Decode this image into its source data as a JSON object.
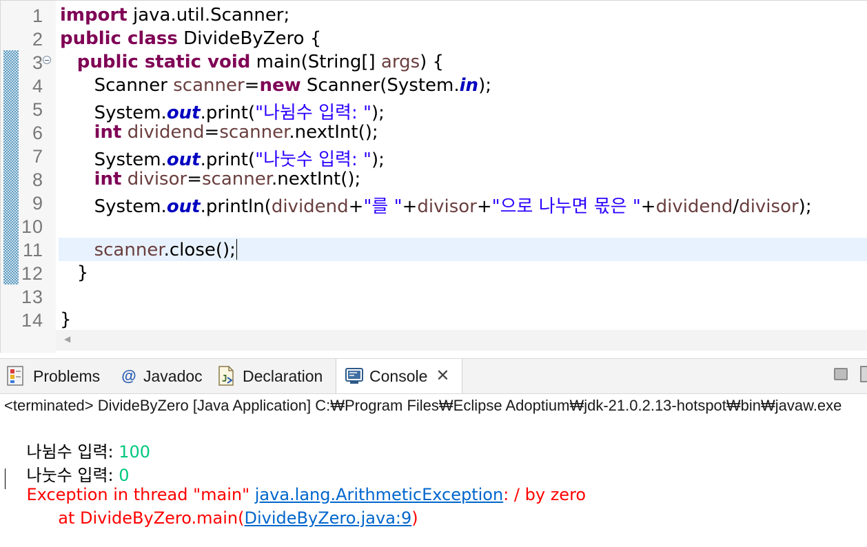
{
  "editor": {
    "lines": [
      {
        "n": "1",
        "tokens": [
          {
            "t": "import",
            "c": "kw"
          },
          {
            "t": " java.util.Scanner;"
          }
        ]
      },
      {
        "n": "2",
        "tokens": [
          {
            "t": "public class",
            "c": "kw"
          },
          {
            "t": " DivideByZero {"
          }
        ]
      },
      {
        "n": "3",
        "tokens": [
          {
            "t": "   "
          },
          {
            "t": "public static void",
            "c": "kw"
          },
          {
            "t": " main(String[] "
          },
          {
            "t": "args",
            "c": "var"
          },
          {
            "t": ") {"
          }
        ]
      },
      {
        "n": "4",
        "tokens": [
          {
            "t": "      Scanner "
          },
          {
            "t": "scanner",
            "c": "var"
          },
          {
            "t": "="
          },
          {
            "t": "new",
            "c": "kw"
          },
          {
            "t": " Scanner(System."
          },
          {
            "t": "in",
            "c": "fld"
          },
          {
            "t": ");"
          }
        ]
      },
      {
        "n": "5",
        "tokens": [
          {
            "t": "      System."
          },
          {
            "t": "out",
            "c": "fld"
          },
          {
            "t": ".print("
          },
          {
            "t": "\"나뉨수 입력: \"",
            "c": "str"
          },
          {
            "t": ");"
          }
        ]
      },
      {
        "n": "6",
        "tokens": [
          {
            "t": "      "
          },
          {
            "t": "int",
            "c": "kw"
          },
          {
            "t": " "
          },
          {
            "t": "dividend",
            "c": "var"
          },
          {
            "t": "="
          },
          {
            "t": "scanner",
            "c": "var"
          },
          {
            "t": ".nextInt();"
          }
        ]
      },
      {
        "n": "7",
        "tokens": [
          {
            "t": "      System."
          },
          {
            "t": "out",
            "c": "fld"
          },
          {
            "t": ".print("
          },
          {
            "t": "\"나눗수 입력: \"",
            "c": "str"
          },
          {
            "t": ");"
          }
        ]
      },
      {
        "n": "8",
        "tokens": [
          {
            "t": "      "
          },
          {
            "t": "int",
            "c": "kw"
          },
          {
            "t": " "
          },
          {
            "t": "divisor",
            "c": "var"
          },
          {
            "t": "="
          },
          {
            "t": "scanner",
            "c": "var"
          },
          {
            "t": ".nextInt();"
          }
        ]
      },
      {
        "n": "9",
        "tokens": [
          {
            "t": "      System."
          },
          {
            "t": "out",
            "c": "fld"
          },
          {
            "t": ".println("
          },
          {
            "t": "dividend",
            "c": "var"
          },
          {
            "t": "+"
          },
          {
            "t": "\"를 \"",
            "c": "str"
          },
          {
            "t": "+"
          },
          {
            "t": "divisor",
            "c": "var"
          },
          {
            "t": "+"
          },
          {
            "t": "\"으로 나누면 몫은 \"",
            "c": "str"
          },
          {
            "t": "+"
          },
          {
            "t": "dividend",
            "c": "var"
          },
          {
            "t": "/"
          },
          {
            "t": "divisor",
            "c": "var"
          },
          {
            "t": ");"
          }
        ]
      },
      {
        "n": "10",
        "tokens": []
      },
      {
        "n": "11",
        "tokens": [
          {
            "t": "      "
          },
          {
            "t": "scanner",
            "c": "var"
          },
          {
            "t": ".close();"
          }
        ],
        "caret": true
      },
      {
        "n": "12",
        "tokens": [
          {
            "t": "   }"
          }
        ]
      },
      {
        "n": "13",
        "tokens": []
      },
      {
        "n": "14",
        "tokens": [
          {
            "t": "}"
          }
        ]
      }
    ]
  },
  "panel": {
    "tabs": [
      {
        "label": "Problems",
        "icon": "problems-icon"
      },
      {
        "label": "Javadoc",
        "icon": "javadoc-icon"
      },
      {
        "label": "Declaration",
        "icon": "declaration-icon"
      },
      {
        "label": "Console",
        "icon": "console-icon",
        "active": true
      }
    ],
    "status": "<terminated> DivideByZero [Java Application] C:₩Program Files₩Eclipse Adoptium₩jdk-21.0.2.13-hotspot₩bin₩javaw.exe",
    "console": {
      "prompt1": "나뉨수 입력: ",
      "input1": "100",
      "prompt2": "나눗수 입력: ",
      "input2": "0",
      "exception_prefix": "Exception in thread \"main\" ",
      "exception_link": "java.lang.ArithmeticException",
      "exception_suffix": ": / by zero",
      "trace_prefix": "      at DivideByZero.main(",
      "trace_link": "DivideByZero.java:9",
      "trace_suffix": ")"
    }
  },
  "colors": {
    "keyword": "#7f0055",
    "local_var": "#6a3e3e",
    "static_field": "#0000c0",
    "string": "#2a00ff",
    "console_input": "#00c87d",
    "error": "#ff0000",
    "link": "#0066cc"
  }
}
